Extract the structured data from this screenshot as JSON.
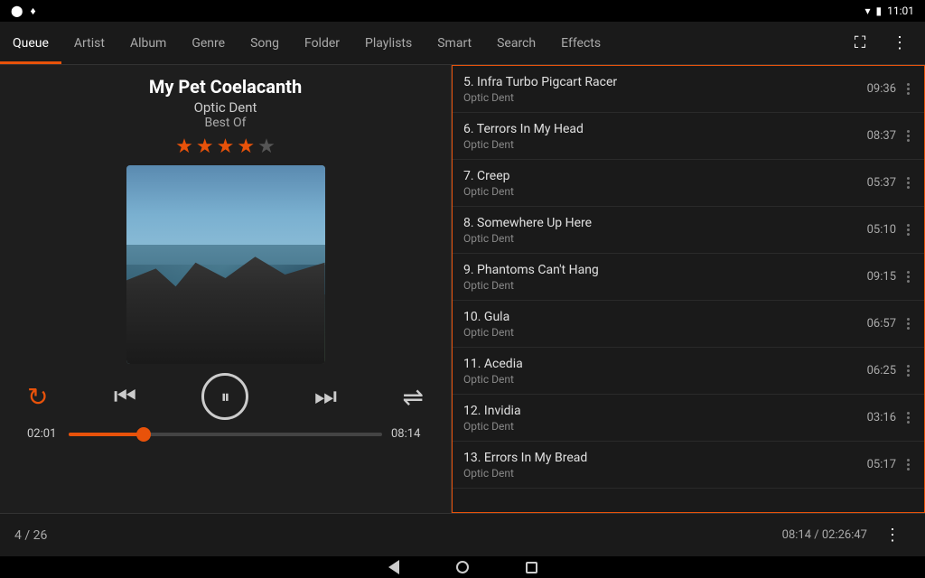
{
  "statusBar": {
    "time": "11:01",
    "icons": [
      "wifi",
      "battery"
    ]
  },
  "navTabs": {
    "tabs": [
      {
        "id": "queue",
        "label": "Queue",
        "active": true
      },
      {
        "id": "artist",
        "label": "Artist",
        "active": false
      },
      {
        "id": "album",
        "label": "Album",
        "active": false
      },
      {
        "id": "genre",
        "label": "Genre",
        "active": false
      },
      {
        "id": "song",
        "label": "Song",
        "active": false
      },
      {
        "id": "folder",
        "label": "Folder",
        "active": false
      },
      {
        "id": "playlists",
        "label": "Playlists",
        "active": false
      },
      {
        "id": "smart",
        "label": "Smart",
        "active": false
      },
      {
        "id": "search",
        "label": "Search",
        "active": false
      },
      {
        "id": "effects",
        "label": "Effects",
        "active": false
      }
    ]
  },
  "player": {
    "songTitle": "My Pet Coelacanth",
    "artist": "Optic Dent",
    "album": "Best Of",
    "rating": 4,
    "maxRating": 5,
    "currentTime": "02:01",
    "totalTime": "08:14",
    "progress": 24
  },
  "tracks": [
    {
      "num": 5,
      "title": "Infra Turbo Pigcart Racer",
      "artist": "Optic Dent",
      "duration": "09:36"
    },
    {
      "num": 6,
      "title": "Terrors In My Head",
      "artist": "Optic Dent",
      "duration": "08:37"
    },
    {
      "num": 7,
      "title": "Creep",
      "artist": "Optic Dent",
      "duration": "05:37"
    },
    {
      "num": 8,
      "title": "Somewhere Up Here",
      "artist": "Optic Dent",
      "duration": "05:10"
    },
    {
      "num": 9,
      "title": "Phantoms Can't Hang",
      "artist": "Optic Dent",
      "duration": "09:15"
    },
    {
      "num": 10,
      "title": "Gula",
      "artist": "Optic Dent",
      "duration": "06:57"
    },
    {
      "num": 11,
      "title": "Acedia",
      "artist": "Optic Dent",
      "duration": "06:25"
    },
    {
      "num": 12,
      "title": "Invidia",
      "artist": "Optic Dent",
      "duration": "03:16"
    },
    {
      "num": 13,
      "title": "Errors In My Bread",
      "artist": "Optic Dent",
      "duration": "05:17"
    }
  ],
  "bottomBar": {
    "queuePosition": "4 / 26",
    "currentDuration": "08:14",
    "totalDuration": "02:26:47"
  }
}
